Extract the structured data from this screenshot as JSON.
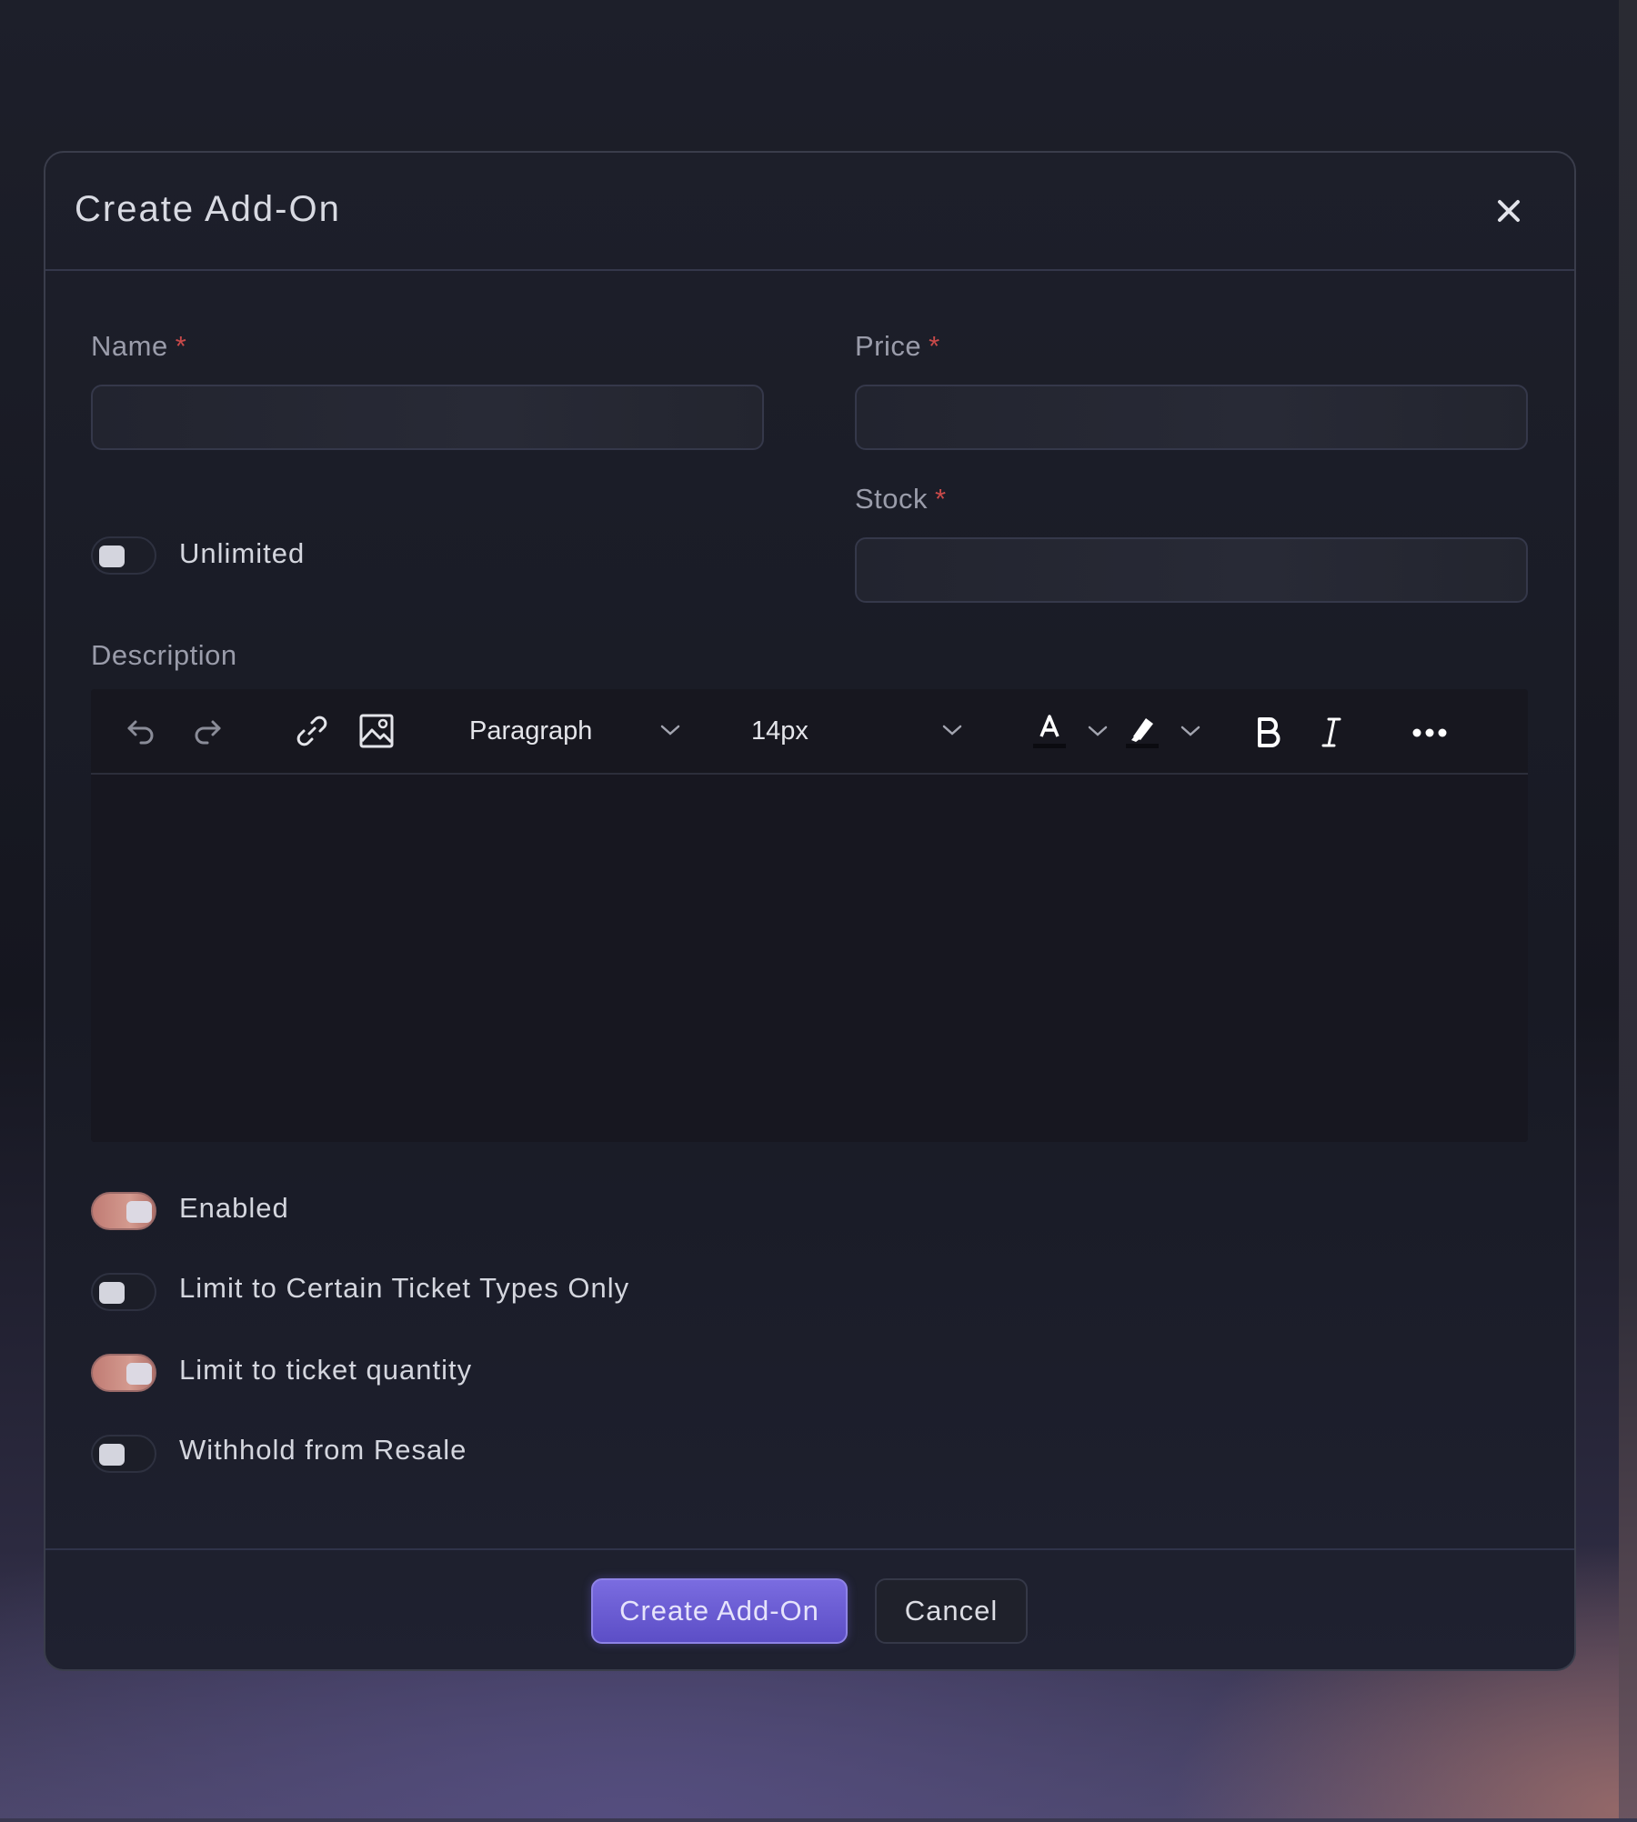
{
  "modal": {
    "title": "Create Add-On",
    "close_icon": "close-icon"
  },
  "form": {
    "name_label": "Name",
    "price_label": "Price",
    "stock_label": "Stock",
    "required_mark": "*",
    "name_value": "",
    "price_value": "",
    "stock_value": "",
    "unlimited_label": "Unlimited",
    "unlimited_on": false,
    "description_label": "Description"
  },
  "editor": {
    "block_format": "Paragraph",
    "font_size": "14px",
    "tools": [
      "undo-icon",
      "redo-icon",
      "link-icon",
      "image-icon",
      "font-color-icon",
      "highlight-icon",
      "bold-icon",
      "italic-icon",
      "more-icon"
    ],
    "content": ""
  },
  "toggles": [
    {
      "label": "Enabled",
      "on": true
    },
    {
      "label": "Limit to Certain Ticket Types Only",
      "on": false
    },
    {
      "label": "Limit to ticket quantity",
      "on": true
    },
    {
      "label": "Withhold from Resale",
      "on": false
    }
  ],
  "footer": {
    "primary_label": "Create Add-On",
    "cancel_label": "Cancel"
  },
  "colors": {
    "accent": "#6a5cd6",
    "toggle_on": "#c98a80",
    "required": "#c94a4a"
  }
}
